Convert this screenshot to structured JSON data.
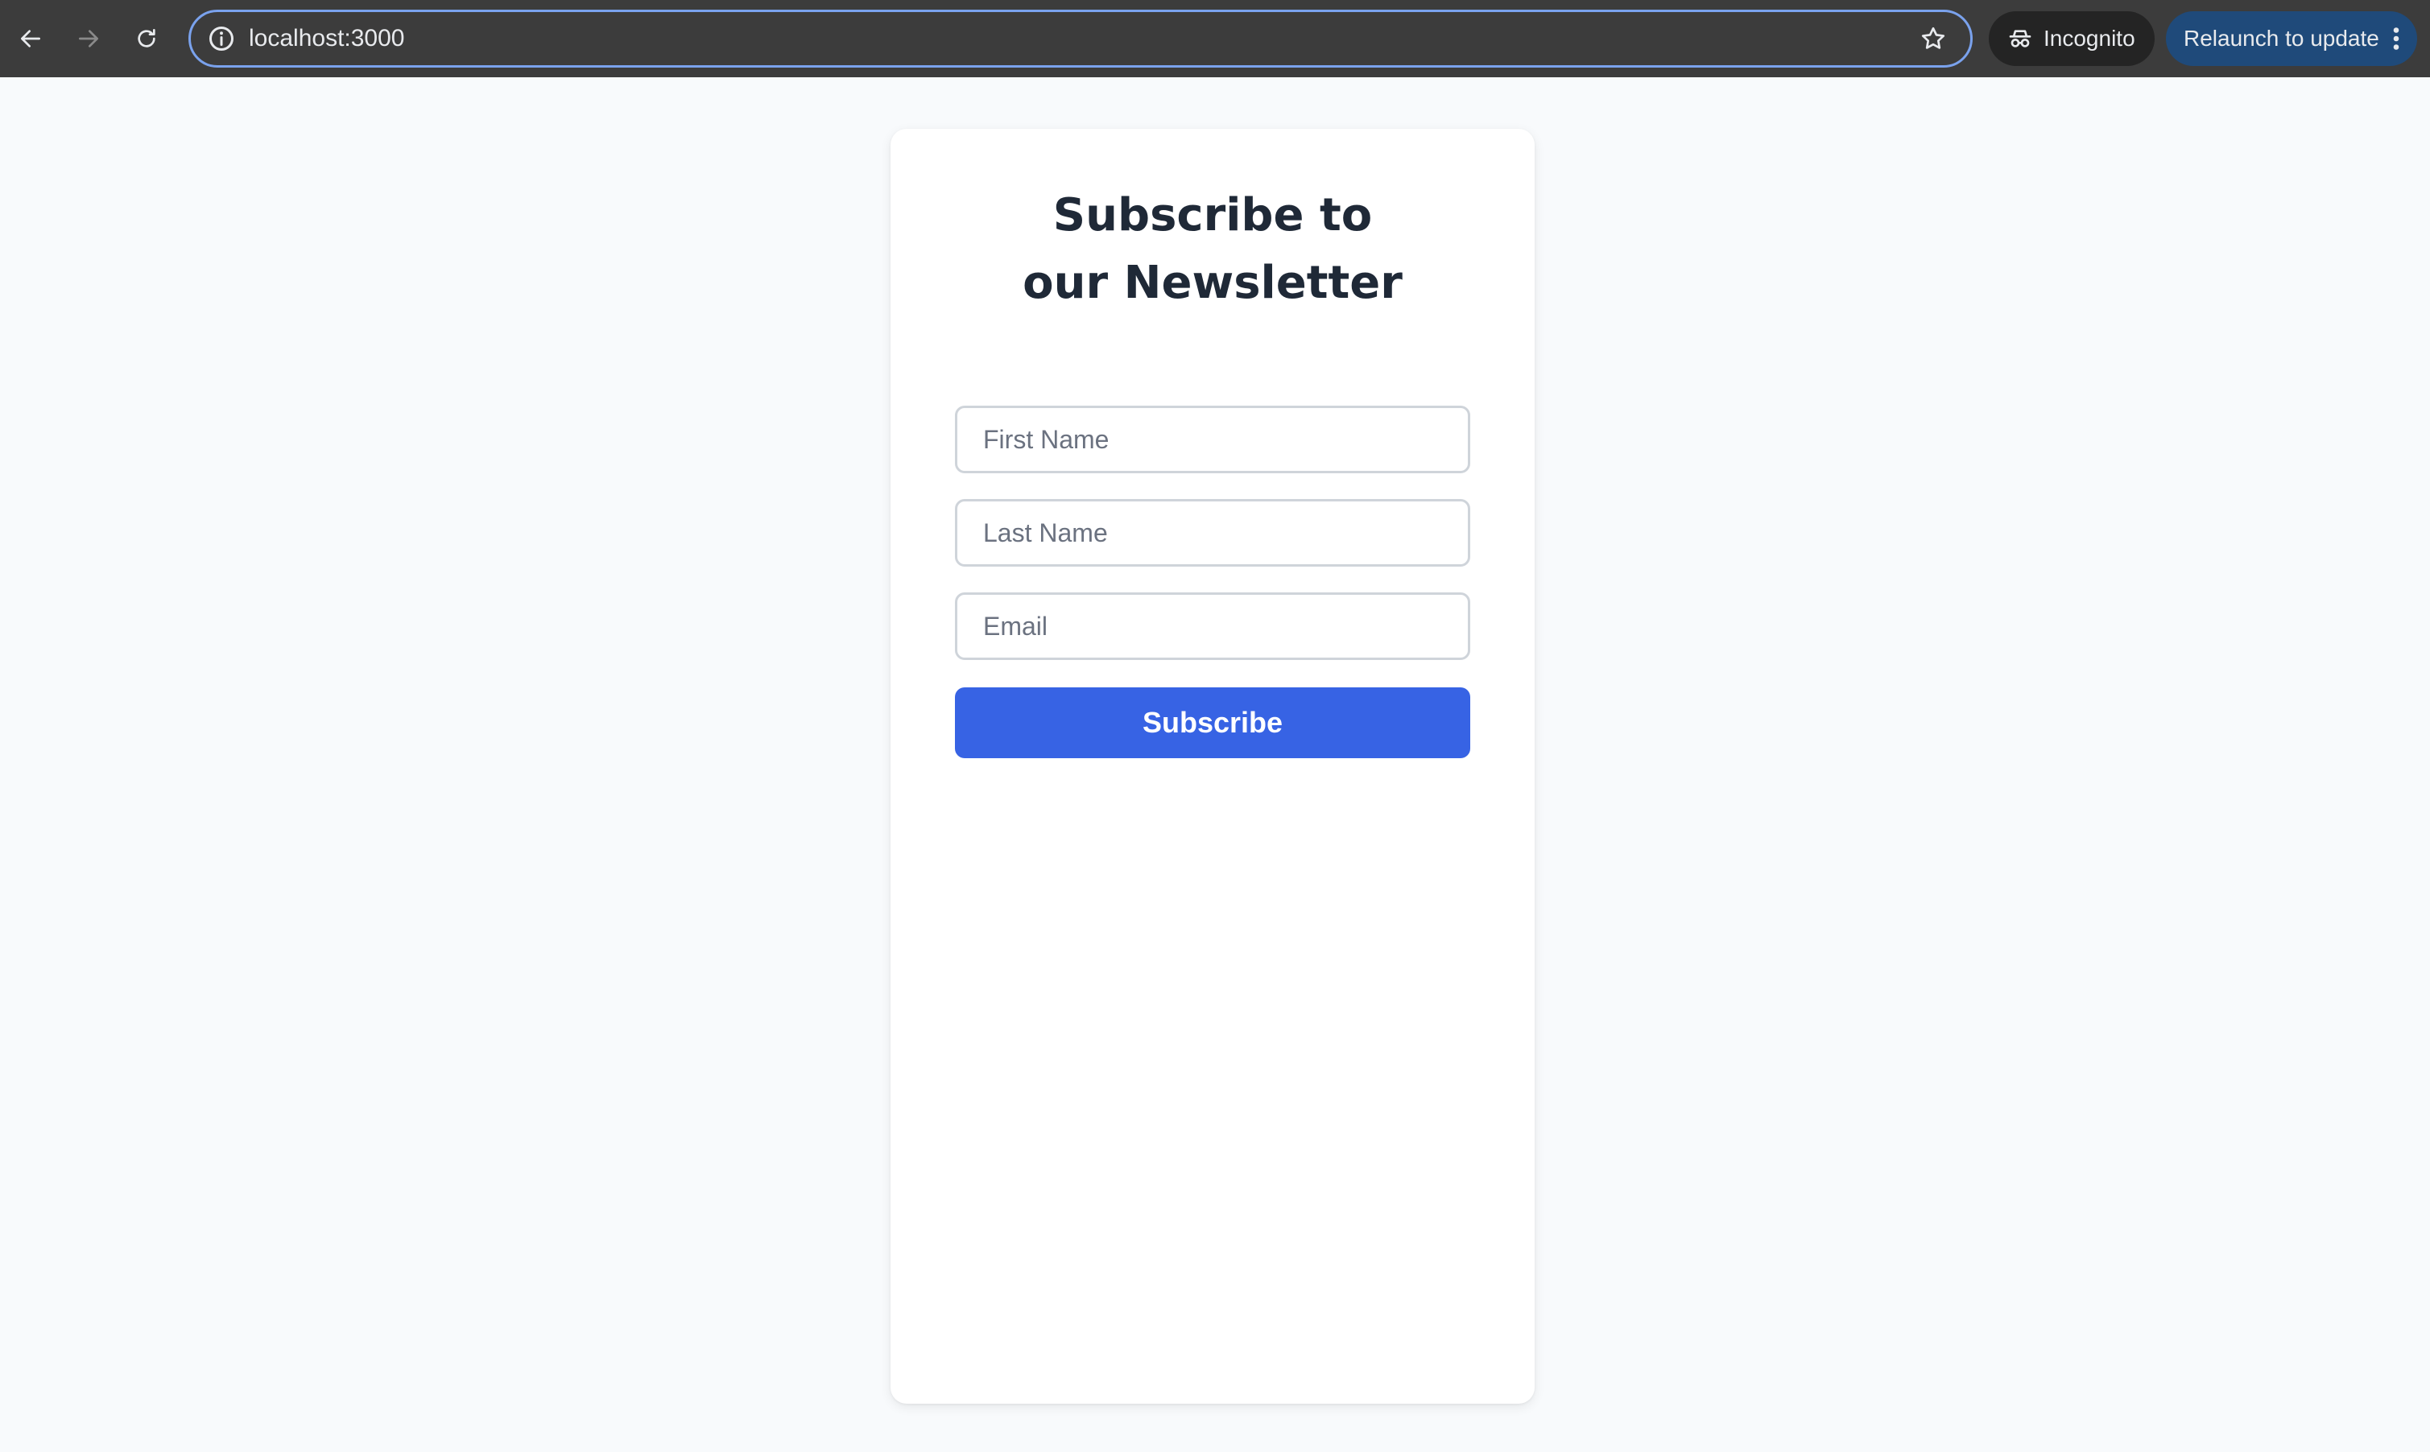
{
  "browser": {
    "url": "localhost:3000",
    "incognito_label": "Incognito",
    "relaunch_label": "Relaunch to update",
    "icons": {
      "back": "arrow-left-icon",
      "forward": "arrow-right-icon",
      "reload": "reload-icon",
      "info": "info-icon",
      "bookmark": "star-icon",
      "incognito": "incognito-icon",
      "menu": "kebab-menu-icon"
    }
  },
  "form": {
    "title": "Subscribe to our Newsletter",
    "fields": {
      "first_name": {
        "placeholder": "First Name",
        "value": ""
      },
      "last_name": {
        "placeholder": "Last Name",
        "value": ""
      },
      "email": {
        "placeholder": "Email",
        "value": ""
      }
    },
    "submit_label": "Subscribe"
  },
  "colors": {
    "chrome_background": "#3c3c3c",
    "omnibox_focus_ring": "#7aa2ed",
    "relaunch_chip": "#1f4a7a",
    "page_background": "#f8fafc",
    "card_background": "#ffffff",
    "title_text": "#1f2937",
    "button_primary": "#3763e4"
  }
}
